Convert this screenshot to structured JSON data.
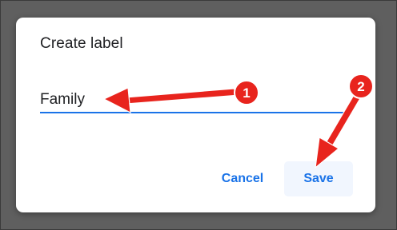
{
  "dialog": {
    "title": "Create label",
    "input": {
      "value": "Family",
      "placeholder": ""
    },
    "buttons": {
      "cancel_label": "Cancel",
      "save_label": "Save"
    }
  },
  "annotations": {
    "marker_1": "1",
    "marker_2": "2",
    "color": "#e8241d"
  },
  "colors": {
    "backdrop": "#5f5f5f",
    "accent": "#1a73e8",
    "save_button_bg": "#f1f6fe",
    "text": "#202124"
  }
}
